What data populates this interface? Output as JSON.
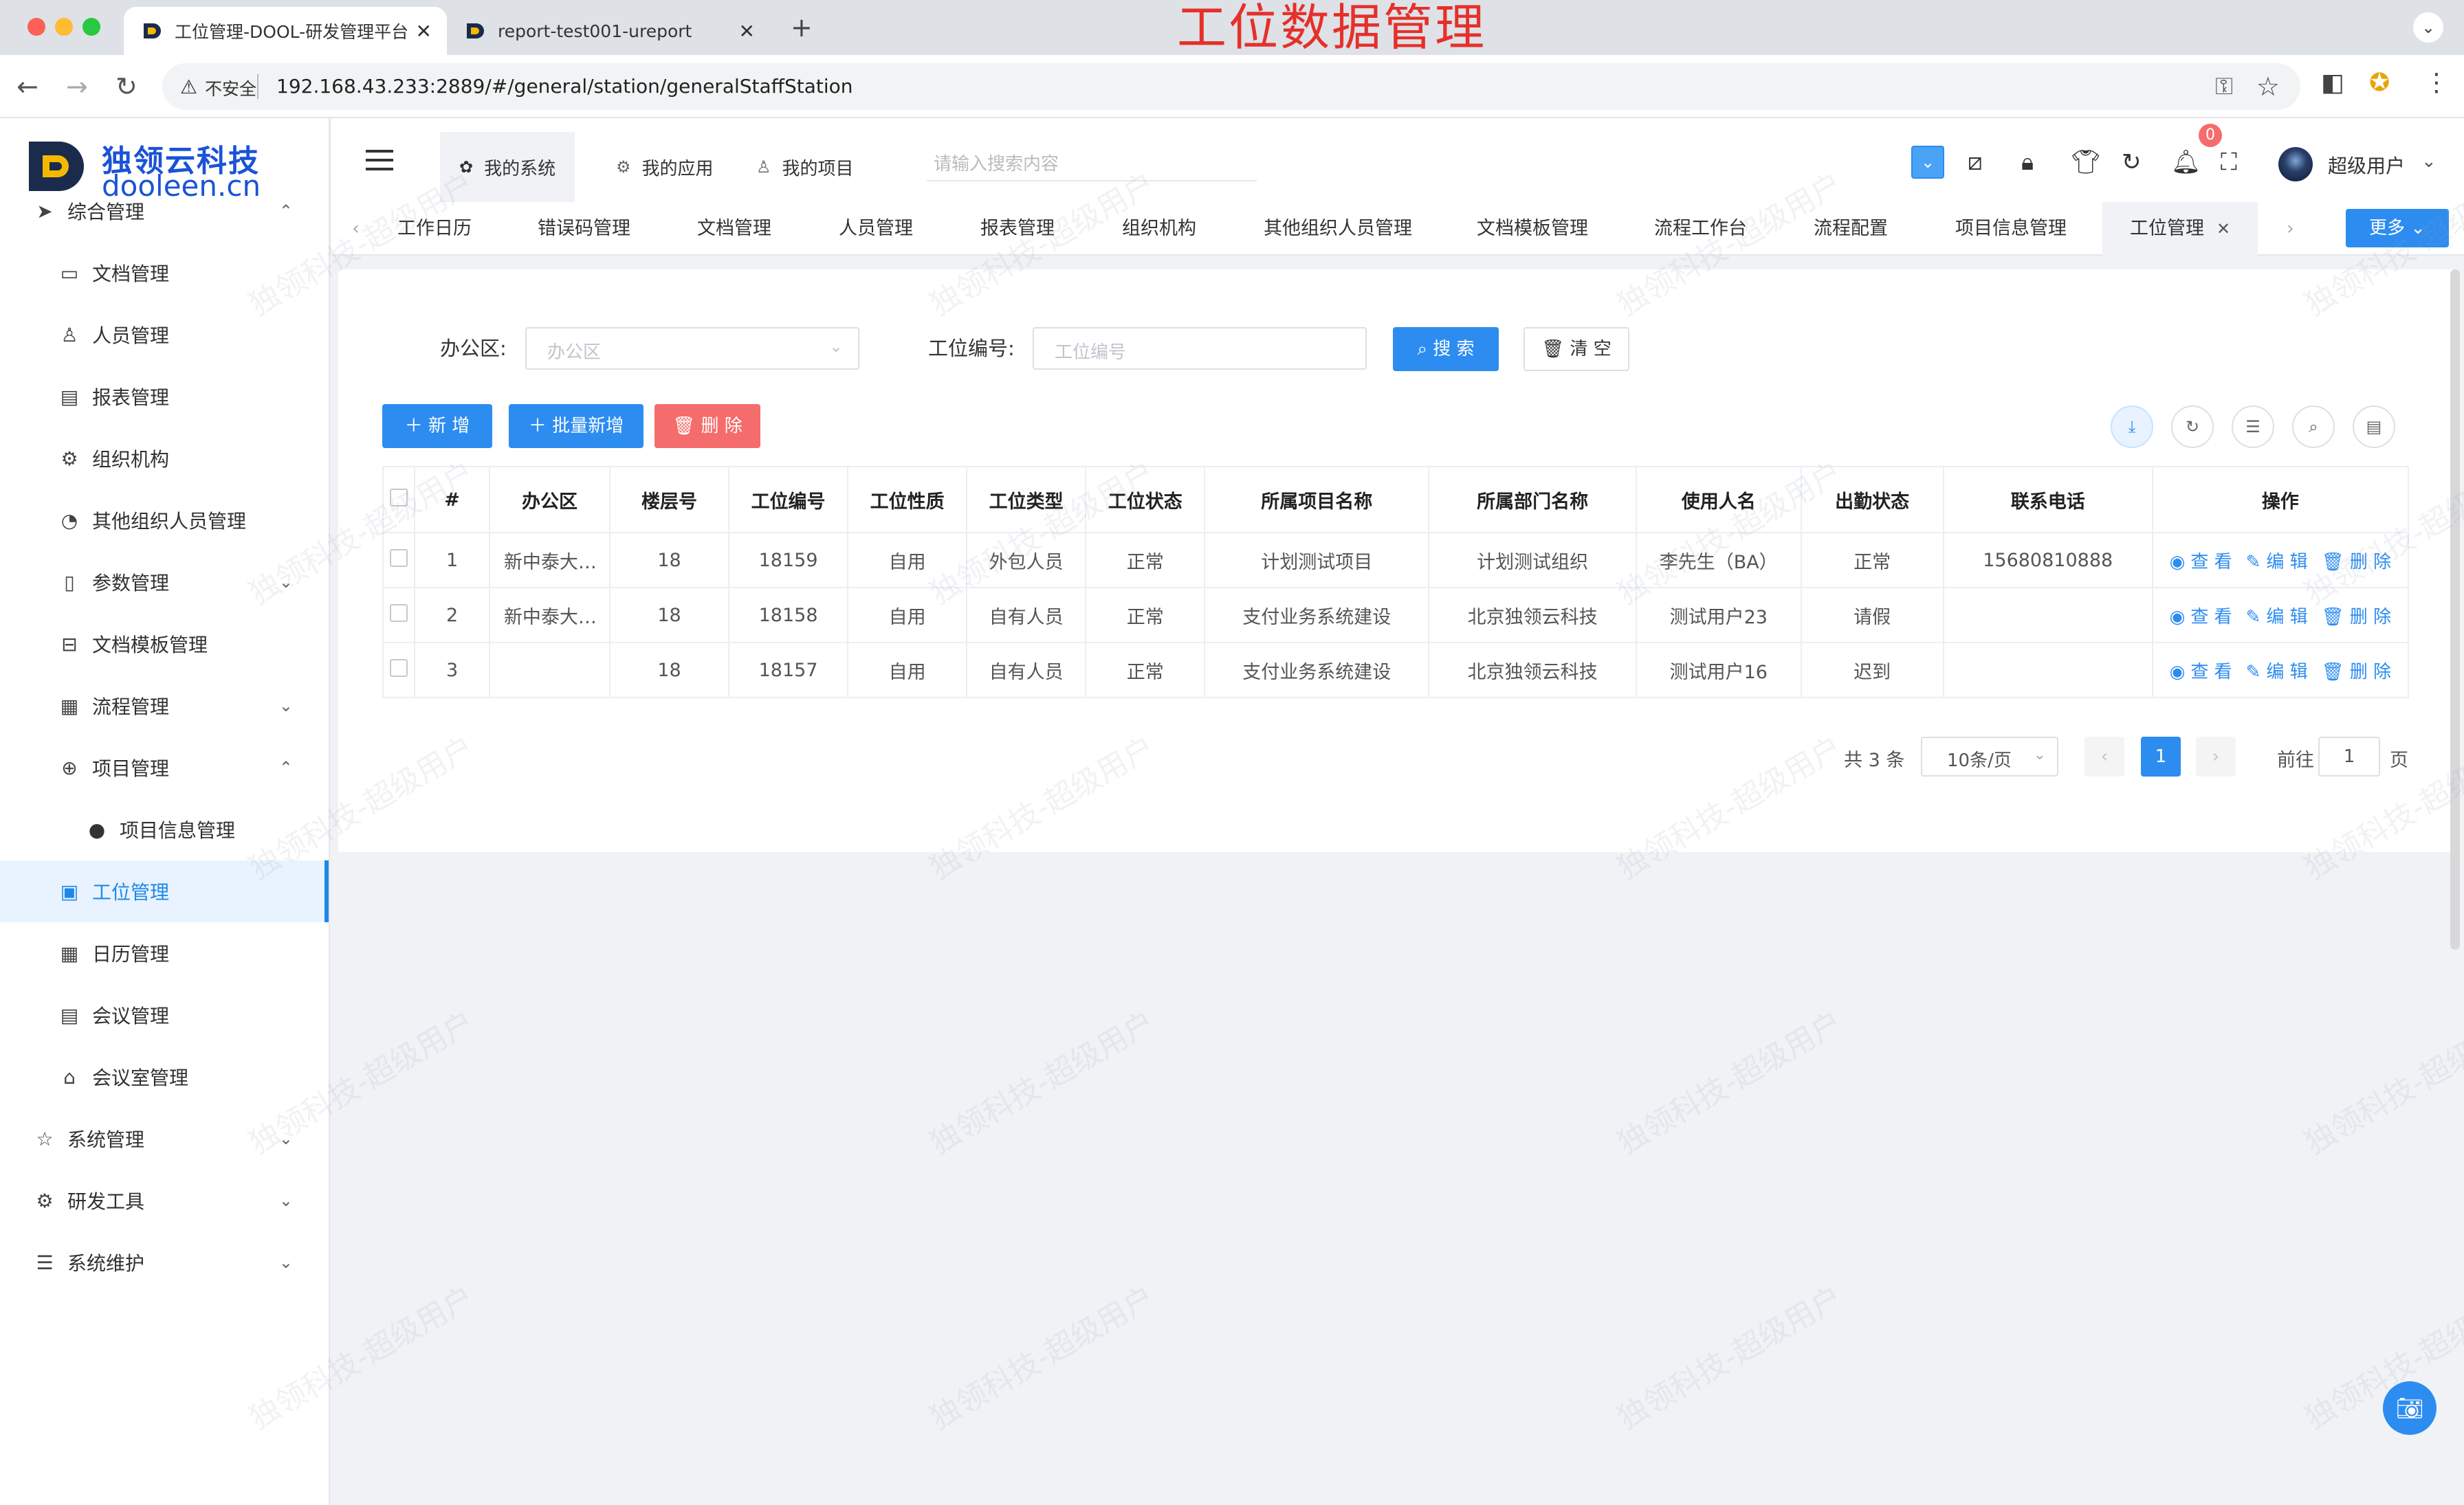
{
  "overlay_title": "工位数据管理",
  "browser": {
    "tabs": [
      {
        "title": "工位管理-DOOL-研发管理平台",
        "close": "✕"
      },
      {
        "title": "report-test001-ureport",
        "close": "✕"
      }
    ],
    "new_tab": "+",
    "insecure_label": "不安全",
    "url": "192.168.43.233:2889/#/general/station/generalStaffStation"
  },
  "logo": {
    "cn": "独领云科技",
    "en": "dooleen.cn"
  },
  "sidebar": {
    "items": [
      {
        "label": "综合管理",
        "icon": "send-icon",
        "chev": "⌃"
      },
      {
        "label": "文档管理",
        "icon": "folder-icon"
      },
      {
        "label": "人员管理",
        "icon": "user-icon"
      },
      {
        "label": "报表管理",
        "icon": "report-icon"
      },
      {
        "label": "组织机构",
        "icon": "gear-icon"
      },
      {
        "label": "其他组织人员管理",
        "icon": "circle-icon"
      },
      {
        "label": "参数管理",
        "icon": "param-icon",
        "chev": "⌄"
      },
      {
        "label": "文档模板管理",
        "icon": "template-icon"
      },
      {
        "label": "流程管理",
        "icon": "calendar-icon",
        "chev": "⌄"
      },
      {
        "label": "项目管理",
        "icon": "plus-circle-icon",
        "chev": "⌃"
      },
      {
        "label": "项目信息管理",
        "icon": "check-circle-icon"
      },
      {
        "label": "工位管理",
        "icon": "clipboard-icon"
      },
      {
        "label": "日历管理",
        "icon": "calendar-icon"
      },
      {
        "label": "会议管理",
        "icon": "doc-icon"
      },
      {
        "label": "会议室管理",
        "icon": "home-icon"
      },
      {
        "label": "系统管理",
        "icon": "star-icon",
        "chev": "⌄"
      },
      {
        "label": "研发工具",
        "icon": "cog-icon",
        "chev": "⌄"
      },
      {
        "label": "系统维护",
        "icon": "sliders-icon",
        "chev": "⌄"
      }
    ]
  },
  "header": {
    "tabs": [
      "我的系统",
      "我的应用",
      "我的项目"
    ],
    "search_placeholder": "请输入搜索内容",
    "badge": "0",
    "user": "超级用户"
  },
  "pagetabs": {
    "items": [
      "工作日历",
      "错误码管理",
      "文档管理",
      "人员管理",
      "报表管理",
      "组织机构",
      "其他组织人员管理",
      "文档模板管理",
      "流程工作台",
      "流程配置",
      "项目信息管理",
      "工位管理"
    ],
    "more": "更多 ⌄"
  },
  "filters": {
    "office_label": "办公区:",
    "office_placeholder": "办公区",
    "station_label": "工位编号:",
    "station_placeholder": "工位编号",
    "search_btn": "搜 索",
    "clear_btn": "清 空"
  },
  "actions": {
    "add": "新 增",
    "batch_add": "批量新增",
    "delete": "删 除"
  },
  "table": {
    "headers": [
      "",
      "#",
      "办公区",
      "楼层号",
      "工位编号",
      "工位性质",
      "工位类型",
      "工位状态",
      "所属项目名称",
      "所属部门名称",
      "使用人名",
      "出勤状态",
      "联系电话",
      "操作"
    ],
    "rows": [
      [
        "1",
        "新中泰大…",
        "18",
        "18159",
        "自用",
        "外包人员",
        "正常",
        "计划测试项目",
        "计划测试组织",
        "李先生（BA）",
        "正常",
        "15680810888"
      ],
      [
        "2",
        "新中泰大…",
        "18",
        "18158",
        "自用",
        "自有人员",
        "正常",
        "支付业务系统建设",
        "北京独领云科技",
        "测试用户23",
        "请假",
        ""
      ],
      [
        "3",
        "",
        "18",
        "18157",
        "自用",
        "自有人员",
        "正常",
        "支付业务系统建设",
        "北京独领云科技",
        "测试用户16",
        "迟到",
        ""
      ]
    ],
    "ops": {
      "view": "查 看",
      "edit": "编 辑",
      "delete": "删 除"
    }
  },
  "pagination": {
    "total": "共 3 条",
    "size": "10条/页",
    "current": "1",
    "goto": "前往",
    "goto_value": "1",
    "unit": "页"
  },
  "watermark": "独领科技-超级用户",
  "colors": {
    "primary": "#2d8cf0",
    "danger": "#f56c6c",
    "title_red": "#e5302a"
  }
}
